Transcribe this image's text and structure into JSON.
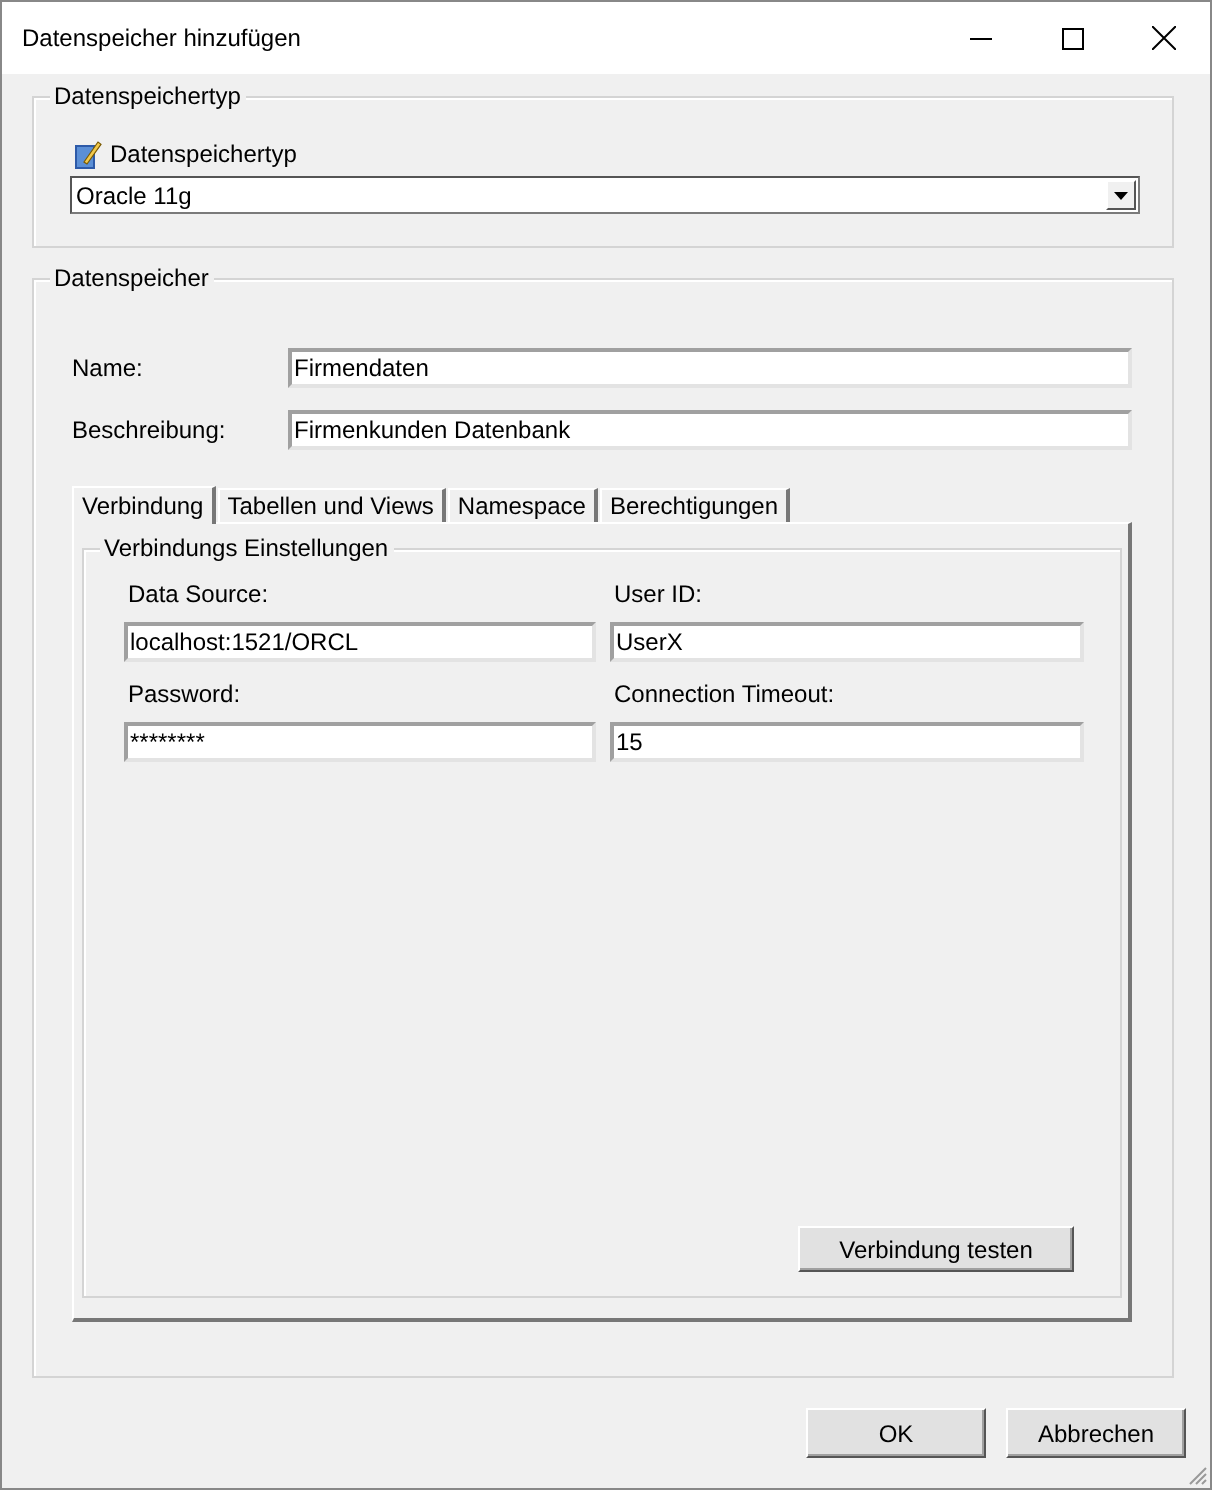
{
  "window": {
    "title": "Datenspeicher hinzufügen"
  },
  "type_group": {
    "title": "Datenspeichertyp",
    "label": "Datenspeichertyp",
    "value": "Oracle 11g"
  },
  "store_group": {
    "title": "Datenspeicher",
    "fields": [
      {
        "label": "Name:",
        "value": "Firmendaten"
      },
      {
        "label": "Beschreibung:",
        "value": "Firmenkunden Datenbank"
      }
    ],
    "tabs": [
      {
        "label": "Verbindung",
        "selected": true
      },
      {
        "label": "Tabellen und Views",
        "selected": false
      },
      {
        "label": "Namespace",
        "selected": false
      },
      {
        "label": "Berechtigungen",
        "selected": false
      }
    ],
    "connection": {
      "title": "Verbindungs Einstellungen",
      "fields": [
        {
          "label": "Data Source:",
          "value": "localhost:1521/ORCL"
        },
        {
          "label": "User ID:",
          "value": "UserX"
        },
        {
          "label": "Password:",
          "value": "********"
        },
        {
          "label": "Connection Timeout:",
          "value": "15"
        }
      ],
      "test_button": "Verbindung testen"
    }
  },
  "buttons": [
    "OK",
    "Abbrechen"
  ]
}
